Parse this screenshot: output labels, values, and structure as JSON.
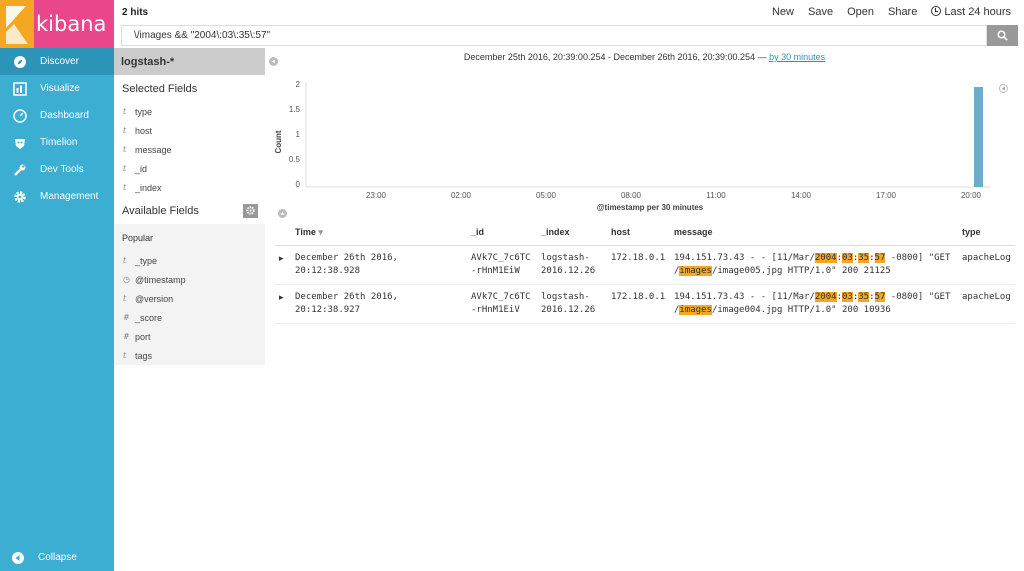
{
  "app": {
    "logo_text": "kibana",
    "brand_color": "#e8488b",
    "nav_color": "#3caed2"
  },
  "nav": {
    "items": [
      {
        "label": "Discover",
        "icon": "compass-icon"
      },
      {
        "label": "Visualize",
        "icon": "bar-chart-icon"
      },
      {
        "label": "Dashboard",
        "icon": "dashboard-icon"
      },
      {
        "label": "Timelion",
        "icon": "timelion-icon"
      },
      {
        "label": "Dev Tools",
        "icon": "wrench-icon"
      },
      {
        "label": "Management",
        "icon": "gear-icon"
      }
    ],
    "collapse_label": "Collapse"
  },
  "topbar": {
    "hits": "2 hits",
    "new_label": "New",
    "save_label": "Save",
    "open_label": "Open",
    "share_label": "Share",
    "time_label": "Last 24 hours"
  },
  "search": {
    "value": "\\/images && \"2004\\:03\\:35\\:57\""
  },
  "fields": {
    "index_pattern": "logstash-*",
    "selected_title": "Selected Fields",
    "selected": [
      {
        "type": "t",
        "name": "type"
      },
      {
        "type": "t",
        "name": "host"
      },
      {
        "type": "t",
        "name": "message"
      },
      {
        "type": "t",
        "name": "_id"
      },
      {
        "type": "t",
        "name": "_index"
      }
    ],
    "available_title": "Available Fields",
    "popular_title": "Popular",
    "available": [
      {
        "type": "t",
        "name": "_type"
      },
      {
        "type": "clock",
        "name": "@timestamp"
      },
      {
        "type": "t",
        "name": "@version"
      },
      {
        "type": "#",
        "name": "_score"
      },
      {
        "type": "#",
        "name": "port"
      },
      {
        "type": "t",
        "name": "tags"
      }
    ]
  },
  "histogram": {
    "range_text": "December 25th 2016, 20:39:00.254 - December 26th 2016, 20:39:00.254 —",
    "interval_link": "by 30 minutes",
    "ylabel": "Count",
    "xlabel": "@timestamp per 30 minutes",
    "y_ticks": [
      "2",
      "1.5",
      "1",
      "0.5",
      "0"
    ],
    "x_ticks": [
      "23:00",
      "02:00",
      "05:00",
      "08:00",
      "11:00",
      "14:00",
      "17:00",
      "20:00"
    ],
    "bar_color": "#6aaecc"
  },
  "chart_data": {
    "type": "bar",
    "title": "",
    "xlabel": "@timestamp per 30 minutes",
    "ylabel": "Count",
    "ylim": [
      0,
      2
    ],
    "categories": [
      "Dec 26 20:00"
    ],
    "values": [
      2
    ]
  },
  "table": {
    "columns": [
      "Time",
      "_id",
      "_index",
      "host",
      "message",
      "type"
    ],
    "rows": [
      {
        "time": "December 26th 2016, 20:12:38.928",
        "id": "AVk7C_7c6TC-rHnM1EiW",
        "index": "logstash-2016.12.26",
        "host": "172.18.0.1",
        "msg_pre": "194.151.73.43 - - [11/Mar/",
        "msg_h1": "2004",
        "msg_h2": "03",
        "msg_h3": "35",
        "msg_h4": "57",
        "msg_mid": " -0800] \"GET /",
        "msg_h5": "images",
        "msg_post": "/image005.jpg HTTP/1.0\" 200 21125",
        "type": "apacheLog"
      },
      {
        "time": "December 26th 2016, 20:12:38.927",
        "id": "AVk7C_7c6TC-rHnM1EiV",
        "index": "logstash-2016.12.26",
        "host": "172.18.0.1",
        "msg_pre": "194.151.73.43 - - [11/Mar/",
        "msg_h1": "2004",
        "msg_h2": "03",
        "msg_h3": "35",
        "msg_h4": "57",
        "msg_mid": " -0800] \"GET /",
        "msg_h5": "images",
        "msg_post": "/image004.jpg HTTP/1.0\" 200 10936",
        "type": "apacheLog"
      }
    ]
  }
}
